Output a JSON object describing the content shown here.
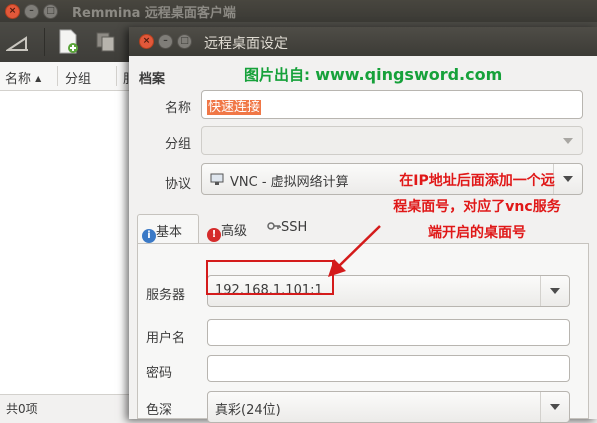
{
  "main_window": {
    "title": "Remmina 远程桌面客户端",
    "columns": [
      "名称",
      "分组",
      "服"
    ],
    "sort_indicator": "▲",
    "status": "共0项"
  },
  "dialog": {
    "title": "远程桌面设定",
    "section_title": "档案",
    "watermark_prefix": "图片出自:",
    "watermark_url": "www.qingsword.com",
    "fields": {
      "name_label": "名称",
      "name_value": "快速连接",
      "group_label": "分组",
      "group_value": "",
      "protocol_label": "协议",
      "protocol_value": "VNC - 虚拟网络计算"
    },
    "tabs": [
      {
        "label": "基本",
        "icon": "info-icon"
      },
      {
        "label": "高级",
        "icon": "stop-icon"
      },
      {
        "label": "SSH",
        "icon": "key-icon"
      }
    ],
    "basic": {
      "server_label": "服务器",
      "server_value": "192.168.1.101:1",
      "username_label": "用户名",
      "username_value": "",
      "password_label": "密码",
      "password_value": "",
      "color_depth_label": "色深",
      "color_depth_value": "真彩(24位)"
    }
  },
  "annotation": {
    "lines": [
      "在IP地址后面添加一个远",
      "程桌面号，对应了vnc服务",
      "端开启的桌面号"
    ],
    "color": "#e01818"
  },
  "colors": {
    "titlebar": "#3c3b36",
    "close_button": "#e2583a",
    "selection": "#f07746",
    "watermark": "#16a13a"
  }
}
